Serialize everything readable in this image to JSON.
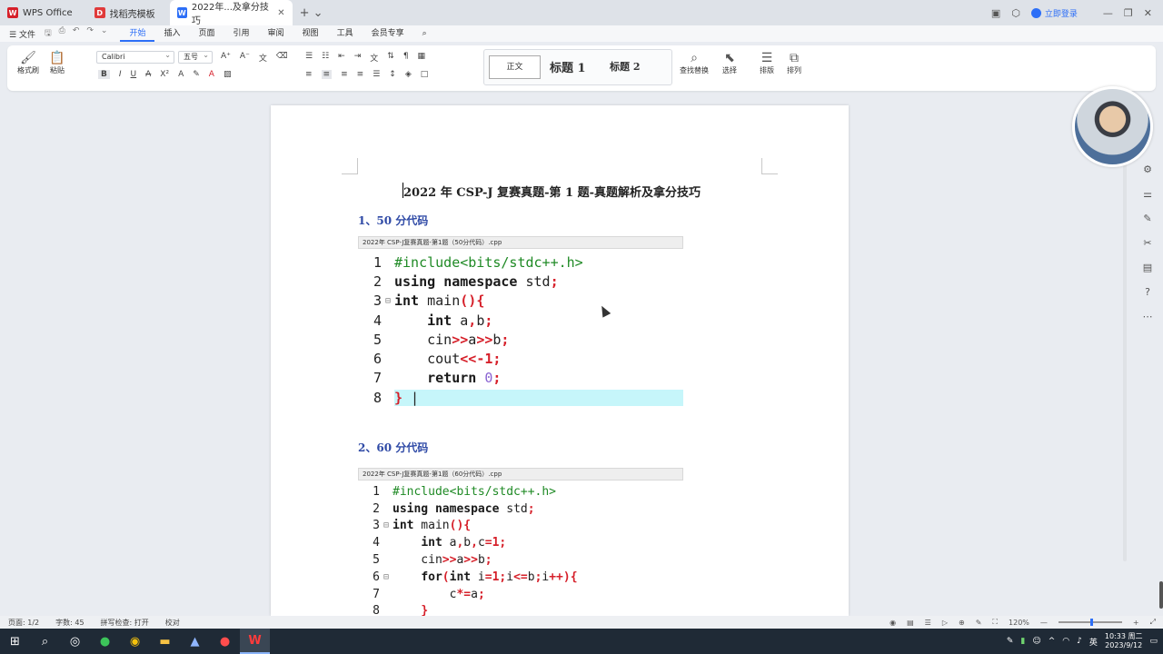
{
  "tabs": [
    {
      "label": "WPS Office",
      "logo": "W",
      "color": "#d6202a"
    },
    {
      "label": "找稻壳模板",
      "logo": "D",
      "color": "#e03a3a"
    },
    {
      "label": "2022年...及拿分技巧",
      "logo": "W",
      "color": "#2d6ff7",
      "active": true
    }
  ],
  "titlebar": {
    "login": "立即登录"
  },
  "menu": {
    "file": "文件",
    "items": [
      "开始",
      "插入",
      "页面",
      "引用",
      "审阅",
      "视图",
      "工具",
      "会员专享"
    ],
    "active": "开始"
  },
  "ribbon": {
    "format_painter": "格式刷",
    "paste": "粘贴",
    "font": "Calibri",
    "size": "五号",
    "style_normal": "正文",
    "style_h1": "标题 1",
    "style_h2": "标题 2",
    "find": "查找替换",
    "select": "选择",
    "layout": "排版",
    "arrange": "排列"
  },
  "document": {
    "title": "2022 年  CSP-J 复赛真题-第 1 题-真题解析及拿分技巧",
    "section1": "1、50 分代码",
    "section2": "2、60 分代码",
    "fig1_caption": "2022年 CSP-J复赛真题-第1题（50分代码）.cpp",
    "fig2_caption": "2022年 CSP-J复赛真题-第1题（60分代码）.cpp"
  },
  "code1": [
    {
      "n": "1",
      "text": "#include<bits/stdc++.h>"
    },
    {
      "n": "2",
      "text": "using namespace std;"
    },
    {
      "n": "3",
      "text": "int main(){"
    },
    {
      "n": "4",
      "text": "    int a,b;"
    },
    {
      "n": "5",
      "text": "    cin>>a>>b;"
    },
    {
      "n": "6",
      "text": "    cout<<-1;"
    },
    {
      "n": "7",
      "text": "    return 0;"
    },
    {
      "n": "8",
      "text": "} |"
    }
  ],
  "code2": [
    {
      "n": "1",
      "text": "#include<bits/stdc++.h>"
    },
    {
      "n": "2",
      "text": "using namespace std;"
    },
    {
      "n": "3",
      "text": "int main(){"
    },
    {
      "n": "4",
      "text": "    int a,b,c=1;"
    },
    {
      "n": "5",
      "text": "    cin>>a>>b;"
    },
    {
      "n": "6",
      "text": "    for(int i=1;i<=b;i++){"
    },
    {
      "n": "7",
      "text": "        c*=a;"
    },
    {
      "n": "8",
      "text": "    }"
    }
  ],
  "status": {
    "page": "页面: 1/2",
    "words": "字数: 45",
    "spell": "拼写检查: 打开",
    "proof": "校对",
    "zoom": "120%"
  },
  "taskbar": {
    "time": "10:33 周二",
    "date": "2023/9/12",
    "ime": "英"
  }
}
